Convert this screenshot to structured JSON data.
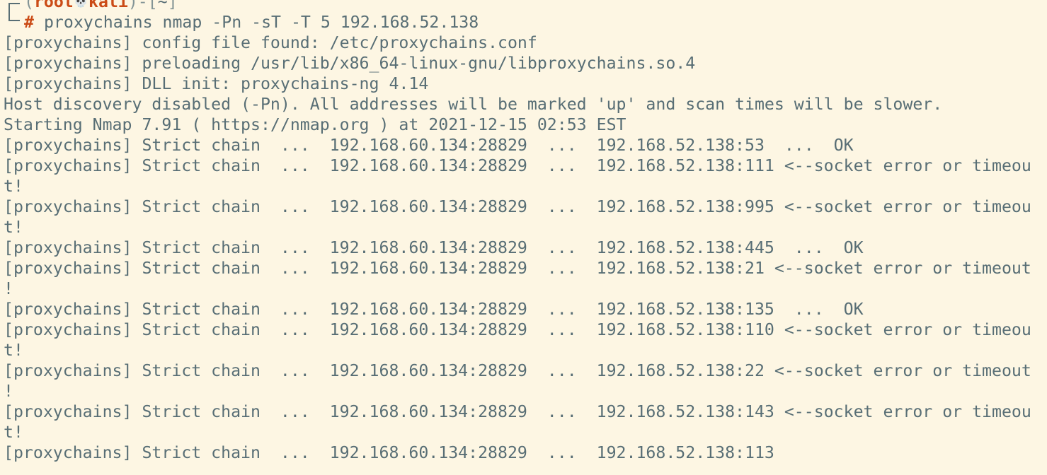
{
  "prompt": {
    "paren_open": "(",
    "user": "root",
    "separator_icon": "skull-icon",
    "separator_glyph": "💀",
    "host": "kali",
    "paren_close": ")-[",
    "path": "~",
    "bracket_close": "]",
    "symbol": "#",
    "command": "proxychains nmap -Pn -sT -T 5 192.168.52.138"
  },
  "output_lines": [
    "[proxychains] config file found: /etc/proxychains.conf",
    "[proxychains] preloading /usr/lib/x86_64-linux-gnu/libproxychains.so.4",
    "[proxychains] DLL init: proxychains-ng 4.14",
    "Host discovery disabled (-Pn). All addresses will be marked 'up' and scan times will be slower.",
    "Starting Nmap 7.91 ( https://nmap.org ) at 2021-12-15 02:53 EST",
    "[proxychains] Strict chain  ...  192.168.60.134:28829  ...  192.168.52.138:53  ...  OK",
    "[proxychains] Strict chain  ...  192.168.60.134:28829  ...  192.168.52.138:111 <--socket error or timeou",
    "t!",
    "[proxychains] Strict chain  ...  192.168.60.134:28829  ...  192.168.52.138:995 <--socket error or timeou",
    "t!",
    "[proxychains] Strict chain  ...  192.168.60.134:28829  ...  192.168.52.138:445  ...  OK",
    "[proxychains] Strict chain  ...  192.168.60.134:28829  ...  192.168.52.138:21 <--socket error or timeout",
    "!",
    "[proxychains] Strict chain  ...  192.168.60.134:28829  ...  192.168.52.138:135  ...  OK",
    "[proxychains] Strict chain  ...  192.168.60.134:28829  ...  192.168.52.138:110 <--socket error or timeou",
    "t!",
    "[proxychains] Strict chain  ...  192.168.60.134:28829  ...  192.168.52.138:22 <--socket error or timeout",
    "!",
    "[proxychains] Strict chain  ...  192.168.60.134:28829  ...  192.168.52.138:143 <--socket error or timeou",
    "t!",
    "[proxychains] Strict chain  ...  192.168.60.134:28829  ...  192.168.52.138:113"
  ],
  "colors": {
    "background": "#fdf6e3",
    "text": "#586e75",
    "prompt_accent": "#cb4b16"
  }
}
